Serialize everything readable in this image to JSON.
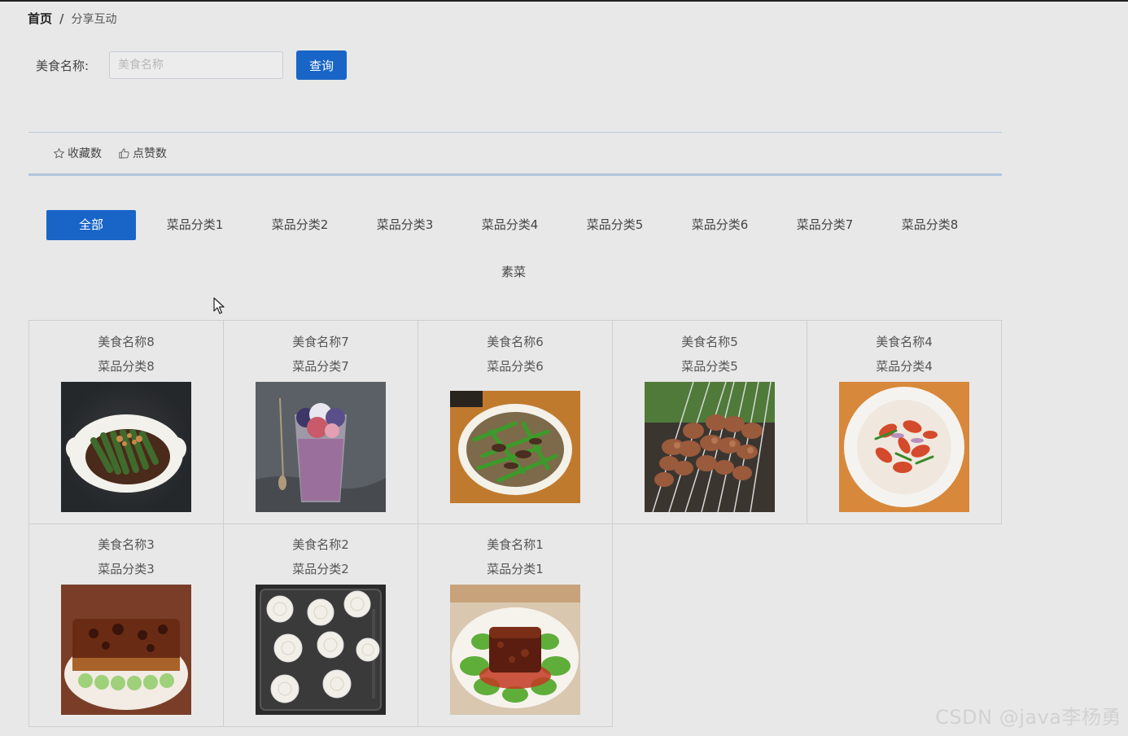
{
  "breadcrumb": {
    "home": "首页",
    "separator": "/",
    "current": "分享互动"
  },
  "search": {
    "label": "美食名称:",
    "placeholder": "美食名称",
    "value": "",
    "button": "查询"
  },
  "sort": [
    {
      "label": "收藏数",
      "icon": "star-icon"
    },
    {
      "label": "点赞数",
      "icon": "thumb-up-icon"
    }
  ],
  "categories": [
    "全部",
    "菜品分类1",
    "菜品分类2",
    "菜品分类3",
    "菜品分类4",
    "菜品分类5",
    "菜品分类6",
    "菜品分类7",
    "菜品分类8"
  ],
  "category_row2": "素菜",
  "active_category": "全部",
  "foods": [
    {
      "name": "美食名称8",
      "category": "菜品分类8",
      "image": "okra-dish"
    },
    {
      "name": "美食名称7",
      "category": "菜品分类7",
      "image": "berry-dessert"
    },
    {
      "name": "美食名称6",
      "category": "菜品分类6",
      "image": "stir-fry-beef-greens"
    },
    {
      "name": "美食名称5",
      "category": "菜品分类5",
      "image": "grilled-skewers"
    },
    {
      "name": "美食名称4",
      "category": "菜品分类4",
      "image": "crayfish-plate"
    },
    {
      "name": "美食名称3",
      "category": "菜品分类3",
      "image": "braised-pork-bok-choy"
    },
    {
      "name": "美食名称2",
      "category": "菜品分类2",
      "image": "mooncakes-tray"
    },
    {
      "name": "美食名称1",
      "category": "菜品分类1",
      "image": "dongpo-pork"
    }
  ],
  "colors": {
    "primary": "#1865c7",
    "background": "#e8e8e8",
    "divider": "#b3c6dd"
  },
  "watermark": "CSDN @java李杨勇"
}
